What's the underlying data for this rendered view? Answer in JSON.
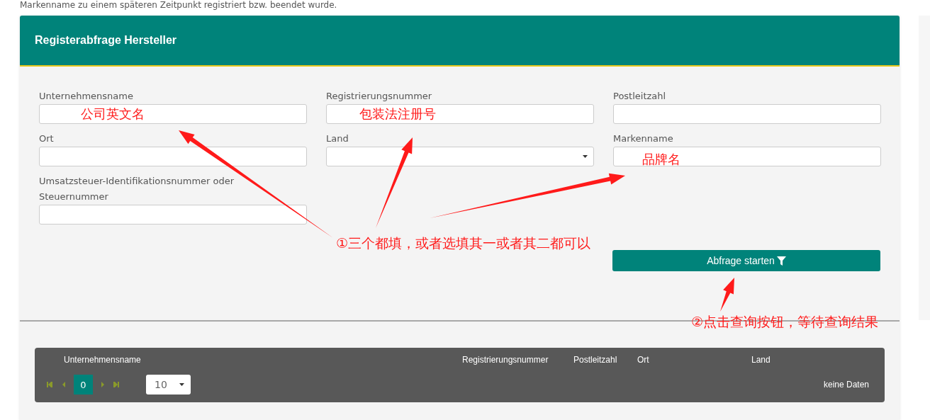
{
  "intro": "Markenname zu einem späteren Zeitpunkt registriert bzw. beendet wurde.",
  "panel": {
    "title": "Registerabfrage Hersteller"
  },
  "fields": [
    {
      "label": "Unternehmensname",
      "kind": "text",
      "annotation": "公司英文名"
    },
    {
      "label": "Registrierungsnummer",
      "kind": "text",
      "annotation": "包装法注册号"
    },
    {
      "label": "Postleitzahl",
      "kind": "text"
    },
    {
      "label": "Ort",
      "kind": "text"
    },
    {
      "label": "Land",
      "kind": "select"
    },
    {
      "label": "Markenname",
      "kind": "text",
      "annotation": "品牌名"
    },
    {
      "label": "Umsatzsteuer-Identifikationsnummer oder Steuernummer",
      "kind": "text"
    }
  ],
  "submit_button": {
    "label": "Abfrage starten"
  },
  "notes": [
    "①三个都填，或者选填其一或者其二都可以",
    "②点击查询按钮，等待查询结果"
  ],
  "table": {
    "columns": [
      "Unternehmensname",
      "Registrierungsnummer",
      "Postleitzahl",
      "Ort",
      "Land"
    ],
    "pager": {
      "page": "0",
      "page_size": "10"
    },
    "empty_text": "keine Daten"
  }
}
